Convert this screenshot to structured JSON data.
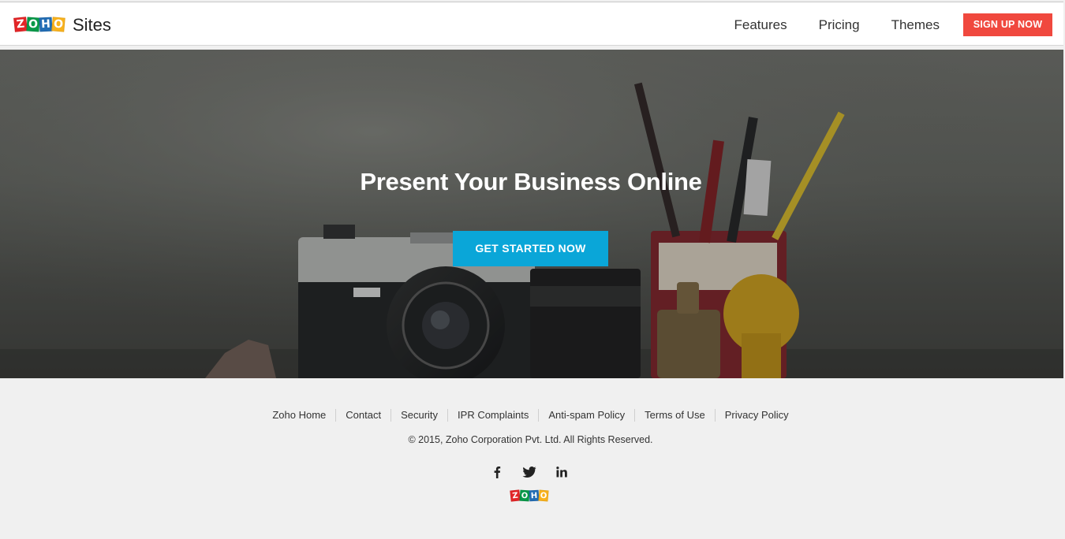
{
  "header": {
    "logo_letters": [
      "Z",
      "O",
      "H",
      "O"
    ],
    "brand": "Sites",
    "nav": [
      "Features",
      "Pricing",
      "Themes"
    ],
    "signup": "SIGN UP NOW"
  },
  "hero": {
    "title": "Present Your Business Online",
    "cta": "GET STARTED NOW"
  },
  "footer": {
    "links": [
      "Zoho Home",
      "Contact",
      "Security",
      "IPR Complaints",
      "Anti-spam Policy",
      "Terms of Use",
      "Privacy Policy"
    ],
    "copyright": "© 2015, Zoho Corporation Pvt. Ltd. All Rights Reserved.",
    "social_icons": [
      "facebook-icon",
      "twitter-icon",
      "linkedin-icon"
    ],
    "logo_letters": [
      "Z",
      "O",
      "H",
      "O"
    ]
  },
  "colors": {
    "signup": "#f0483e",
    "cta": "#0aa6d8",
    "logo_z": "#e42527",
    "logo_o1": "#089949",
    "logo_h": "#226db4",
    "logo_o2": "#f9b21d"
  }
}
